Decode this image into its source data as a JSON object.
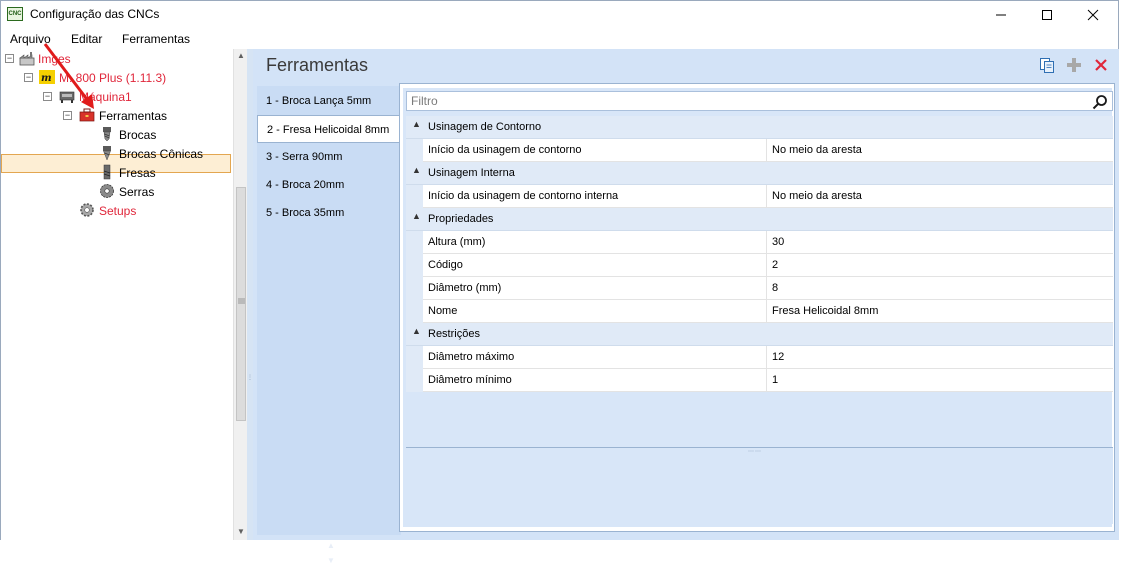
{
  "window": {
    "title": "Configuração das CNCs",
    "app_icon_text": "CNC",
    "minimize_icon": "minimize-icon",
    "maximize_icon": "maximize-icon",
    "close_icon": "close-icon"
  },
  "menu": {
    "items": [
      "Arquivo",
      "Editar",
      "Ferramentas"
    ]
  },
  "tree": {
    "items": [
      {
        "label": "Imges",
        "icon": "factory-icon",
        "level": 0,
        "expanded": true,
        "color": "#e0263a"
      },
      {
        "label": "M. 800 Plus (1.11.3)",
        "icon": "machine-logo-icon",
        "level": 1,
        "expanded": true,
        "color": "#e0263a"
      },
      {
        "label": "Máquina1",
        "icon": "cnc-machine-icon",
        "level": 2,
        "expanded": true,
        "color": "#e0263a"
      },
      {
        "label": "Ferramentas",
        "icon": "toolbox-icon",
        "level": 3,
        "expanded": true,
        "selected": true,
        "color": "#000000"
      },
      {
        "label": "Brocas",
        "icon": "drill-bit-icon",
        "level": 4,
        "color": "#000000"
      },
      {
        "label": "Brocas Cônicas",
        "icon": "conical-drill-icon",
        "level": 4,
        "color": "#000000"
      },
      {
        "label": "Fresas",
        "icon": "end-mill-icon",
        "level": 4,
        "color": "#000000"
      },
      {
        "label": "Serras",
        "icon": "saw-blade-icon",
        "level": 4,
        "color": "#000000"
      },
      {
        "label": "Setups",
        "icon": "gear-icon",
        "level": 3,
        "color": "#e0263a"
      }
    ]
  },
  "right": {
    "title": "Ferramentas",
    "toolbar_icons": [
      "copy-icon",
      "add-icon",
      "delete-icon"
    ],
    "tools": [
      {
        "label": "1 - Broca Lança 5mm"
      },
      {
        "label": "2 - Fresa Helicoidal 8mm",
        "active": true
      },
      {
        "label": "3 - Serra 90mm"
      },
      {
        "label": "4 - Broca 20mm"
      },
      {
        "label": "5 - Broca 35mm"
      }
    ],
    "filter_placeholder": "Filtro",
    "categories": [
      {
        "name": "Usinagem de Contorno",
        "props": [
          {
            "name": "Início da usinagem de contorno",
            "value": "No meio da aresta"
          }
        ]
      },
      {
        "name": "Usinagem Interna",
        "props": [
          {
            "name": "Início da usinagem de contorno interna",
            "value": "No meio da aresta"
          }
        ]
      },
      {
        "name": "Propriedades",
        "props": [
          {
            "name": "Altura (mm)",
            "value": "30"
          },
          {
            "name": "Código",
            "value": "2"
          },
          {
            "name": "Diâmetro (mm)",
            "value": "8"
          },
          {
            "name": "Nome",
            "value": "Fresa Helicoidal 8mm"
          }
        ]
      },
      {
        "name": "Restrições",
        "props": [
          {
            "name": "Diâmetro máximo",
            "value": "12"
          },
          {
            "name": "Diâmetro mínimo",
            "value": "1"
          }
        ]
      }
    ]
  },
  "colors": {
    "accent_blue": "#d3e3f7",
    "selection_bg": "#fdeed4",
    "tree_red": "#e0263a",
    "annotation_arrow": "#e01b1b"
  }
}
